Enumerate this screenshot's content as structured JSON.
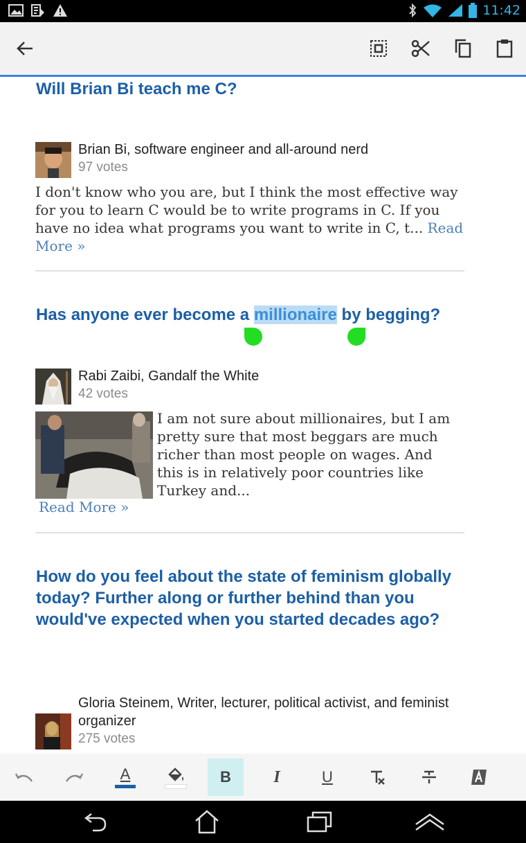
{
  "status_bar": {
    "time": "11:42"
  },
  "toolbar": {
    "back_icon": "arrow-left-icon",
    "select_all_icon": "select-all-icon",
    "cut_icon": "scissors-icon",
    "copy_icon": "copy-icon",
    "paste_icon": "clipboard-icon"
  },
  "questions": [
    {
      "title": "Will Brian Bi teach me C?",
      "author_name": "Brian Bi",
      "author_desc": ", software engineer and all-around nerd",
      "votes": "97 votes",
      "answer": "I don't know who you are, but I think the most effective way for you to learn C would be to write programs in C. If you have no idea what programs you want to write in C, t...",
      "read_more": "Read More »"
    },
    {
      "title_before": "Has anyone ever become a ",
      "title_selected": "millionaire",
      "title_after": " by begging?",
      "author_name": "Rabi Zaibi",
      "author_desc": ", Gandalf the White",
      "votes": "42 votes",
      "answer": "I am not sure about millionaires, but I am pretty sure that most beggars are much richer than most people on wages. And this is in relatively poor countries like Turkey and...",
      "read_more": "Read More »"
    },
    {
      "title": "How do you feel about the state of feminism globally today? Further along or further behind than you would've expected when you started decades ago?",
      "author_name": "Gloria Steinem",
      "author_desc": ", Writer, lecturer, political activist, and feminist organizer",
      "votes": "275 votes"
    }
  ],
  "format_bar": {
    "bold_label": "B",
    "italic_label": "I",
    "underline_label": "U",
    "text_color_label": "A",
    "colors": {
      "text_color_bar": "#1c5fa6",
      "selection": "#bcdcf5",
      "handle": "#22dd22",
      "title": "#1c5fa6"
    }
  }
}
